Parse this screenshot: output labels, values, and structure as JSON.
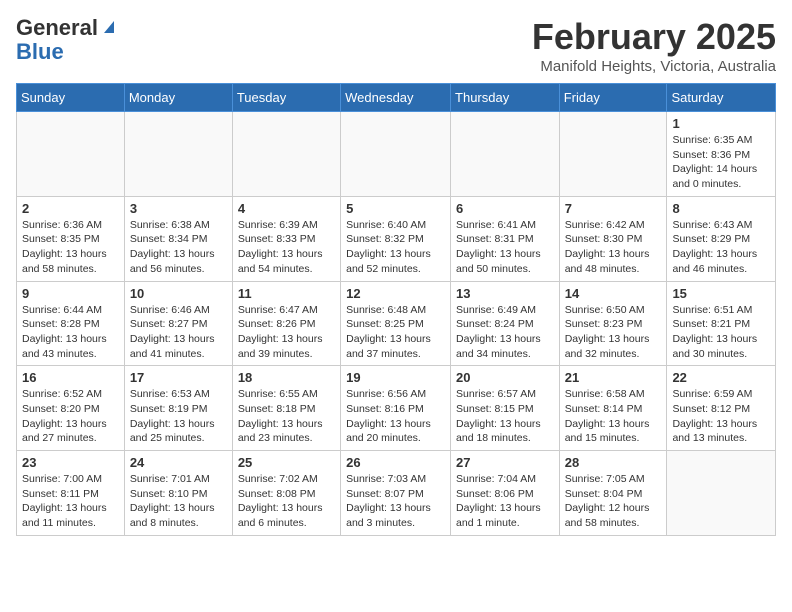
{
  "header": {
    "logo_general": "General",
    "logo_blue": "Blue",
    "month_title": "February 2025",
    "location": "Manifold Heights, Victoria, Australia"
  },
  "weekdays": [
    "Sunday",
    "Monday",
    "Tuesday",
    "Wednesday",
    "Thursday",
    "Friday",
    "Saturday"
  ],
  "weeks": [
    [
      {
        "day": "",
        "info": ""
      },
      {
        "day": "",
        "info": ""
      },
      {
        "day": "",
        "info": ""
      },
      {
        "day": "",
        "info": ""
      },
      {
        "day": "",
        "info": ""
      },
      {
        "day": "",
        "info": ""
      },
      {
        "day": "1",
        "info": "Sunrise: 6:35 AM\nSunset: 8:36 PM\nDaylight: 14 hours\nand 0 minutes."
      }
    ],
    [
      {
        "day": "2",
        "info": "Sunrise: 6:36 AM\nSunset: 8:35 PM\nDaylight: 13 hours\nand 58 minutes."
      },
      {
        "day": "3",
        "info": "Sunrise: 6:38 AM\nSunset: 8:34 PM\nDaylight: 13 hours\nand 56 minutes."
      },
      {
        "day": "4",
        "info": "Sunrise: 6:39 AM\nSunset: 8:33 PM\nDaylight: 13 hours\nand 54 minutes."
      },
      {
        "day": "5",
        "info": "Sunrise: 6:40 AM\nSunset: 8:32 PM\nDaylight: 13 hours\nand 52 minutes."
      },
      {
        "day": "6",
        "info": "Sunrise: 6:41 AM\nSunset: 8:31 PM\nDaylight: 13 hours\nand 50 minutes."
      },
      {
        "day": "7",
        "info": "Sunrise: 6:42 AM\nSunset: 8:30 PM\nDaylight: 13 hours\nand 48 minutes."
      },
      {
        "day": "8",
        "info": "Sunrise: 6:43 AM\nSunset: 8:29 PM\nDaylight: 13 hours\nand 46 minutes."
      }
    ],
    [
      {
        "day": "9",
        "info": "Sunrise: 6:44 AM\nSunset: 8:28 PM\nDaylight: 13 hours\nand 43 minutes."
      },
      {
        "day": "10",
        "info": "Sunrise: 6:46 AM\nSunset: 8:27 PM\nDaylight: 13 hours\nand 41 minutes."
      },
      {
        "day": "11",
        "info": "Sunrise: 6:47 AM\nSunset: 8:26 PM\nDaylight: 13 hours\nand 39 minutes."
      },
      {
        "day": "12",
        "info": "Sunrise: 6:48 AM\nSunset: 8:25 PM\nDaylight: 13 hours\nand 37 minutes."
      },
      {
        "day": "13",
        "info": "Sunrise: 6:49 AM\nSunset: 8:24 PM\nDaylight: 13 hours\nand 34 minutes."
      },
      {
        "day": "14",
        "info": "Sunrise: 6:50 AM\nSunset: 8:23 PM\nDaylight: 13 hours\nand 32 minutes."
      },
      {
        "day": "15",
        "info": "Sunrise: 6:51 AM\nSunset: 8:21 PM\nDaylight: 13 hours\nand 30 minutes."
      }
    ],
    [
      {
        "day": "16",
        "info": "Sunrise: 6:52 AM\nSunset: 8:20 PM\nDaylight: 13 hours\nand 27 minutes."
      },
      {
        "day": "17",
        "info": "Sunrise: 6:53 AM\nSunset: 8:19 PM\nDaylight: 13 hours\nand 25 minutes."
      },
      {
        "day": "18",
        "info": "Sunrise: 6:55 AM\nSunset: 8:18 PM\nDaylight: 13 hours\nand 23 minutes."
      },
      {
        "day": "19",
        "info": "Sunrise: 6:56 AM\nSunset: 8:16 PM\nDaylight: 13 hours\nand 20 minutes."
      },
      {
        "day": "20",
        "info": "Sunrise: 6:57 AM\nSunset: 8:15 PM\nDaylight: 13 hours\nand 18 minutes."
      },
      {
        "day": "21",
        "info": "Sunrise: 6:58 AM\nSunset: 8:14 PM\nDaylight: 13 hours\nand 15 minutes."
      },
      {
        "day": "22",
        "info": "Sunrise: 6:59 AM\nSunset: 8:12 PM\nDaylight: 13 hours\nand 13 minutes."
      }
    ],
    [
      {
        "day": "23",
        "info": "Sunrise: 7:00 AM\nSunset: 8:11 PM\nDaylight: 13 hours\nand 11 minutes."
      },
      {
        "day": "24",
        "info": "Sunrise: 7:01 AM\nSunset: 8:10 PM\nDaylight: 13 hours\nand 8 minutes."
      },
      {
        "day": "25",
        "info": "Sunrise: 7:02 AM\nSunset: 8:08 PM\nDaylight: 13 hours\nand 6 minutes."
      },
      {
        "day": "26",
        "info": "Sunrise: 7:03 AM\nSunset: 8:07 PM\nDaylight: 13 hours\nand 3 minutes."
      },
      {
        "day": "27",
        "info": "Sunrise: 7:04 AM\nSunset: 8:06 PM\nDaylight: 13 hours\nand 1 minute."
      },
      {
        "day": "28",
        "info": "Sunrise: 7:05 AM\nSunset: 8:04 PM\nDaylight: 12 hours\nand 58 minutes."
      },
      {
        "day": "",
        "info": ""
      }
    ]
  ]
}
